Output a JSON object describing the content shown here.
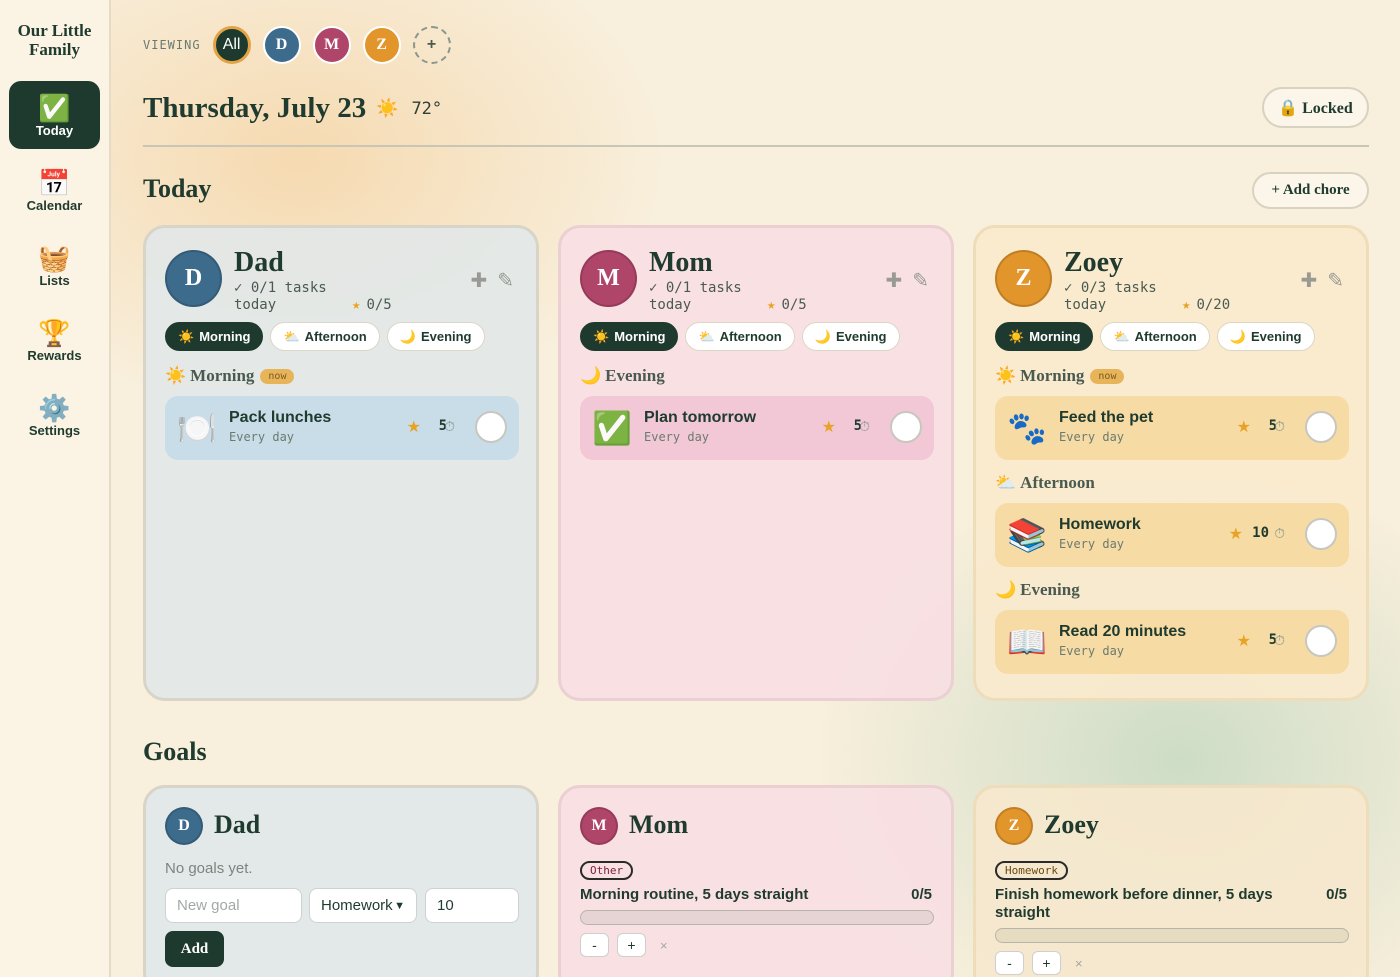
{
  "brand": "Our Little Family",
  "nav": [
    {
      "icon": "✅",
      "label": "Today"
    },
    {
      "icon": "📅",
      "label": "Calendar"
    },
    {
      "icon": "🧺",
      "label": "Lists"
    },
    {
      "icon": "🏆",
      "label": "Rewards"
    },
    {
      "icon": "⚙️",
      "label": "Settings"
    }
  ],
  "viewing": {
    "label": "VIEWING",
    "chips": [
      "All",
      "D",
      "M",
      "Z"
    ],
    "add": "+"
  },
  "header": {
    "date": "Thursday, July 23",
    "weather_icon": "☀️",
    "temp": "72°",
    "locked": "🔒 Locked"
  },
  "today": {
    "title": "Today",
    "add_chore": "+ Add chore",
    "tabs": [
      {
        "icon": "☀️",
        "label": "Morning"
      },
      {
        "icon": "⛅",
        "label": "Afternoon"
      },
      {
        "icon": "🌙",
        "label": "Evening"
      }
    ],
    "now": "now",
    "cards": [
      {
        "initial": "D",
        "name": "Dad",
        "tasks": "✓ 0/1 tasks today",
        "points": "0/5",
        "groups": [
          {
            "icon": "☀️",
            "label": "Morning",
            "now": true,
            "chores": [
              {
                "icon": "🍽️",
                "title": "Pack lunches",
                "sub": "Every day",
                "pts": "5"
              }
            ]
          }
        ]
      },
      {
        "initial": "M",
        "name": "Mom",
        "tasks": "✓ 0/1 tasks today",
        "points": "0/5",
        "groups": [
          {
            "icon": "🌙",
            "label": "Evening",
            "now": false,
            "chores": [
              {
                "icon": "✅",
                "title": "Plan tomorrow",
                "sub": "Every day",
                "pts": "5"
              }
            ]
          }
        ]
      },
      {
        "initial": "Z",
        "name": "Zoey",
        "tasks": "✓ 0/3 tasks today",
        "points": "0/20",
        "groups": [
          {
            "icon": "☀️",
            "label": "Morning",
            "now": true,
            "chores": [
              {
                "icon": "🐾",
                "title": "Feed the pet",
                "sub": "Every day",
                "pts": "5"
              }
            ]
          },
          {
            "icon": "⛅",
            "label": "Afternoon",
            "now": false,
            "chores": [
              {
                "icon": "📚",
                "title": "Homework",
                "sub": "Every day",
                "pts": "10"
              }
            ]
          },
          {
            "icon": "🌙",
            "label": "Evening",
            "now": false,
            "chores": [
              {
                "icon": "📖",
                "title": "Read 20 minutes",
                "sub": "Every day",
                "pts": "5"
              }
            ]
          }
        ]
      }
    ]
  },
  "goals": {
    "title": "Goals",
    "dad": {
      "initial": "D",
      "name": "Dad",
      "empty": "No goals yet.",
      "new_goal_placeholder": "New goal",
      "category": "Homework",
      "target": "10",
      "add": "Add"
    },
    "mom": {
      "initial": "M",
      "name": "Mom",
      "category": "Other",
      "goal": "Morning routine, 5 days straight",
      "progress": "0/5",
      "fraction": 0
    },
    "zoey": {
      "initial": "Z",
      "name": "Zoey",
      "category": "Homework",
      "goal": "Finish homework before dinner, 5 days straight",
      "progress": "0/5",
      "fraction": 0
    },
    "minus": "-",
    "plus": "+",
    "remove": "×"
  },
  "colors": {
    "dark_green": "#1e3a2f",
    "dad": "#3d6b8c",
    "mom": "#b0456a",
    "zoey": "#e2952a",
    "star": "#e8a326"
  }
}
